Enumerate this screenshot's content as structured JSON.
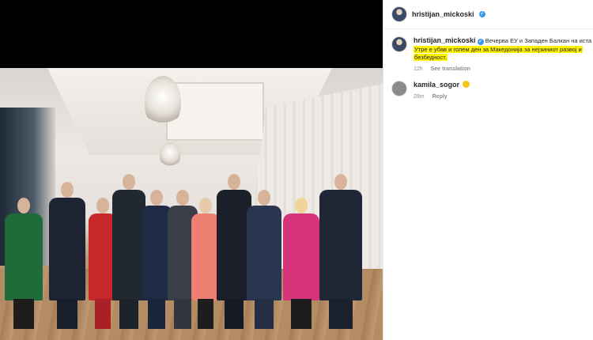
{
  "post": {
    "header": {
      "username": "hristijan_mickoski"
    }
  },
  "comments": [
    {
      "username": "hristijan_mickoski",
      "text_line1": "Вечерва ЕУ и Западен Балкан на иста мас",
      "text_line2": "Утре е убав и голем ден за Македонија за нејзиниот развој и",
      "text_line3": "безбедност.",
      "time": "12h",
      "action": "See translation"
    },
    {
      "username": "kamila_sogor",
      "emoji": "clapping-hands-emoji",
      "time": "28m",
      "action": "Reply"
    }
  ],
  "icons": {
    "verified": "verified-badge-icon"
  },
  "colors": {
    "highlight": "#fff200",
    "verified": "#3897f0"
  }
}
